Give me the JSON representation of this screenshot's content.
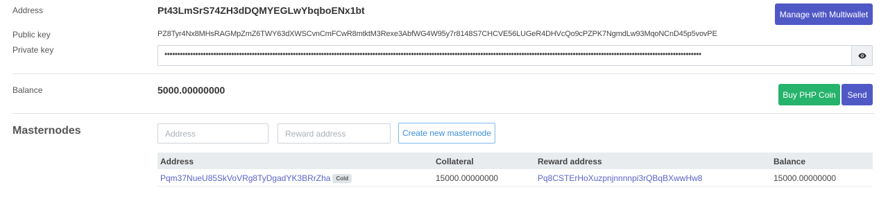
{
  "wallet": {
    "address_label": "Address",
    "address_value": "Pt43LmSrS74ZH3dDQMYEGLwYbqboENx1bt",
    "public_key_label": "Public key",
    "public_key_value": "PZ8Tyr4Nx8MHsRAGMpZmZ6TWY63dXWSCvnCmFCwR8mtktM3Rexe3AbfWG4W95y7r8148S7CHCVE56LUGeR4DHVcQo9cPZPK7NgmdLw93MqoNCnD45p5vovPE",
    "private_key_label": "Private key",
    "private_key_masked": "•••••••••••••••••••••••••••••••••••••••••••••••••••••••••••••••••••••••••••••••••••••••••••••••••••••••••••••••••••••••••••••••••••••••••••••••••••••••••••••••••••••••••••••••••••••••••••••••••••••••••••••••••",
    "manage_button": "Manage with Multiwallet",
    "balance_label": "Balance",
    "balance_value": "5000.00000000",
    "buy_button": "Buy PHP Coin",
    "send_button": "Send"
  },
  "masternodes": {
    "title": "Masternodes",
    "address_placeholder": "Address",
    "reward_placeholder": "Reward address",
    "create_button": "Create new masternode",
    "columns": [
      "Address",
      "Collateral",
      "Reward address",
      "Balance"
    ],
    "rows": [
      {
        "address": "Pqm37NueU85SkVoVRg8TyDgadYK3BRrZha",
        "badge": "Cold",
        "collateral": "15000.00000000",
        "reward_address": "Pq8CSTErHoXuzpnjnnnnpi3rQBqBXwwHw8",
        "balance": "15000.00000000"
      }
    ]
  },
  "icons": {
    "reveal": "eye-icon"
  },
  "colors": {
    "primary": "#5058c6",
    "success": "#26b36b",
    "link": "#5b63c9"
  }
}
